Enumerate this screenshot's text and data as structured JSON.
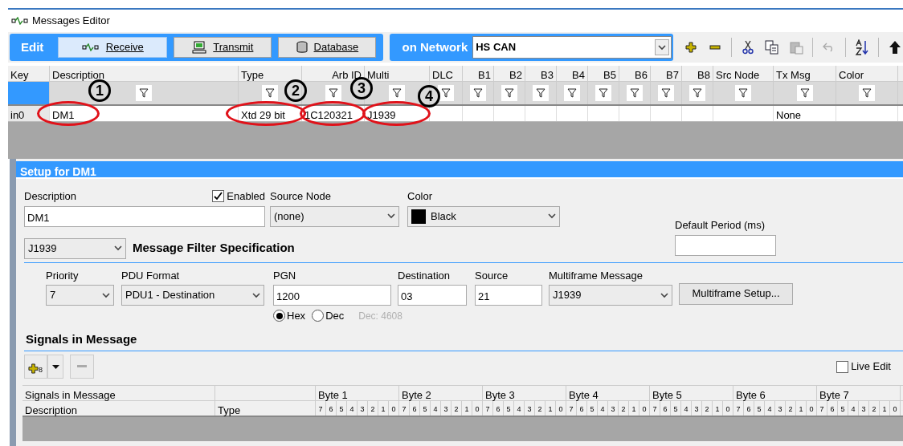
{
  "window": {
    "title": "Messages Editor"
  },
  "toolbar": {
    "mode_label": "Edit",
    "tabs": [
      {
        "label": "Receive",
        "selected": true
      },
      {
        "label": "Transmit",
        "selected": false
      },
      {
        "label": "Database",
        "selected": false
      }
    ],
    "network_label": "on Network",
    "network": "HS CAN",
    "paste_disabled": true,
    "undo_disabled": true
  },
  "grid": {
    "columns": [
      {
        "label": "Key",
        "filter": false
      },
      {
        "label": "Description",
        "filter": true
      },
      {
        "label": "Type",
        "filter": true
      },
      {
        "label": "Arb ID",
        "filter": true
      },
      {
        "label": "Multi",
        "filter": true
      },
      {
        "label": "DLC",
        "filter": true
      },
      {
        "label": "B1",
        "filter": true
      },
      {
        "label": "B2",
        "filter": true
      },
      {
        "label": "B3",
        "filter": true
      },
      {
        "label": "B4",
        "filter": true
      },
      {
        "label": "B5",
        "filter": true
      },
      {
        "label": "B6",
        "filter": true
      },
      {
        "label": "B7",
        "filter": true
      },
      {
        "label": "B8",
        "filter": true
      },
      {
        "label": "Src Node",
        "filter": true
      },
      {
        "label": "Tx Msg",
        "filter": true
      },
      {
        "label": "Color",
        "filter": true
      }
    ],
    "rows": [
      {
        "cells": [
          {
            "text": "in0",
            "circled": false
          },
          {
            "text": "DM1",
            "circled": true
          },
          {
            "text": "Xtd 29 bit",
            "circled": true
          },
          {
            "text": "1C120321",
            "circled": true
          },
          {
            "text": "J1939",
            "circled": true
          },
          {},
          {},
          {},
          {},
          {},
          {},
          {},
          {},
          {},
          {},
          {
            "text": "None",
            "circled": false
          },
          {}
        ]
      }
    ]
  },
  "annotations": [
    {
      "label": "1"
    },
    {
      "label": "2"
    },
    {
      "label": "3"
    },
    {
      "label": "4"
    }
  ],
  "setup": {
    "title": "Setup for DM1",
    "description": {
      "label": "Description",
      "value": "DM1"
    },
    "enabled": {
      "label": "Enabled",
      "checked": true
    },
    "source_node": {
      "label": "Source Node",
      "value": "(none)"
    },
    "color": {
      "label": "Color",
      "value": "Black",
      "color": "#000000"
    },
    "default_period": {
      "label": "Default Period (ms)"
    },
    "protocol": "J1939",
    "filter_title": "Message Filter Specification",
    "priority": {
      "label": "Priority",
      "value": "7"
    },
    "pdu_format": {
      "label": "PDU Format",
      "value": "PDU1 - Destination"
    },
    "pgn": {
      "label": "PGN",
      "value": "1200"
    },
    "radix": [
      {
        "label": "Hex",
        "selected": true
      },
      {
        "label": "Dec",
        "selected": false
      }
    ],
    "dec_hint": "Dec: 4608",
    "destination": {
      "label": "Destination",
      "value": "03"
    },
    "source": {
      "label": "Source",
      "value": "21"
    },
    "multiframe": {
      "label": "Multiframe Message",
      "value": "J1939"
    },
    "multiframe_button": "Multiframe Setup..."
  },
  "signals": {
    "title": "Signals in Message",
    "add_count": "8",
    "live_edit": {
      "label": "Live Edit",
      "checked": false
    },
    "table": {
      "group_label": "Signals in Message",
      "description_label": "Description",
      "type_label": "Type",
      "bytes": [
        {
          "label": "Byte 1",
          "bits": [
            "7",
            "6",
            "5",
            "4",
            "3",
            "2",
            "1",
            "0"
          ]
        },
        {
          "label": "Byte 2",
          "bits": [
            "7",
            "6",
            "5",
            "4",
            "3",
            "2",
            "1",
            "0"
          ]
        },
        {
          "label": "Byte 3",
          "bits": [
            "7",
            "6",
            "5",
            "4",
            "3",
            "2",
            "1",
            "0"
          ]
        },
        {
          "label": "Byte 4",
          "bits": [
            "7",
            "6",
            "5",
            "4",
            "3",
            "2",
            "1",
            "0"
          ]
        },
        {
          "label": "Byte 5",
          "bits": [
            "7",
            "6",
            "5",
            "4",
            "3",
            "2",
            "1",
            "0"
          ]
        },
        {
          "label": "Byte 6",
          "bits": [
            "7",
            "6",
            "5",
            "4",
            "3",
            "2",
            "1",
            "0"
          ]
        },
        {
          "label": "Byte 7",
          "bits": [
            "7",
            "6",
            "5",
            "4",
            "3",
            "2",
            "1",
            "0"
          ]
        }
      ]
    }
  }
}
